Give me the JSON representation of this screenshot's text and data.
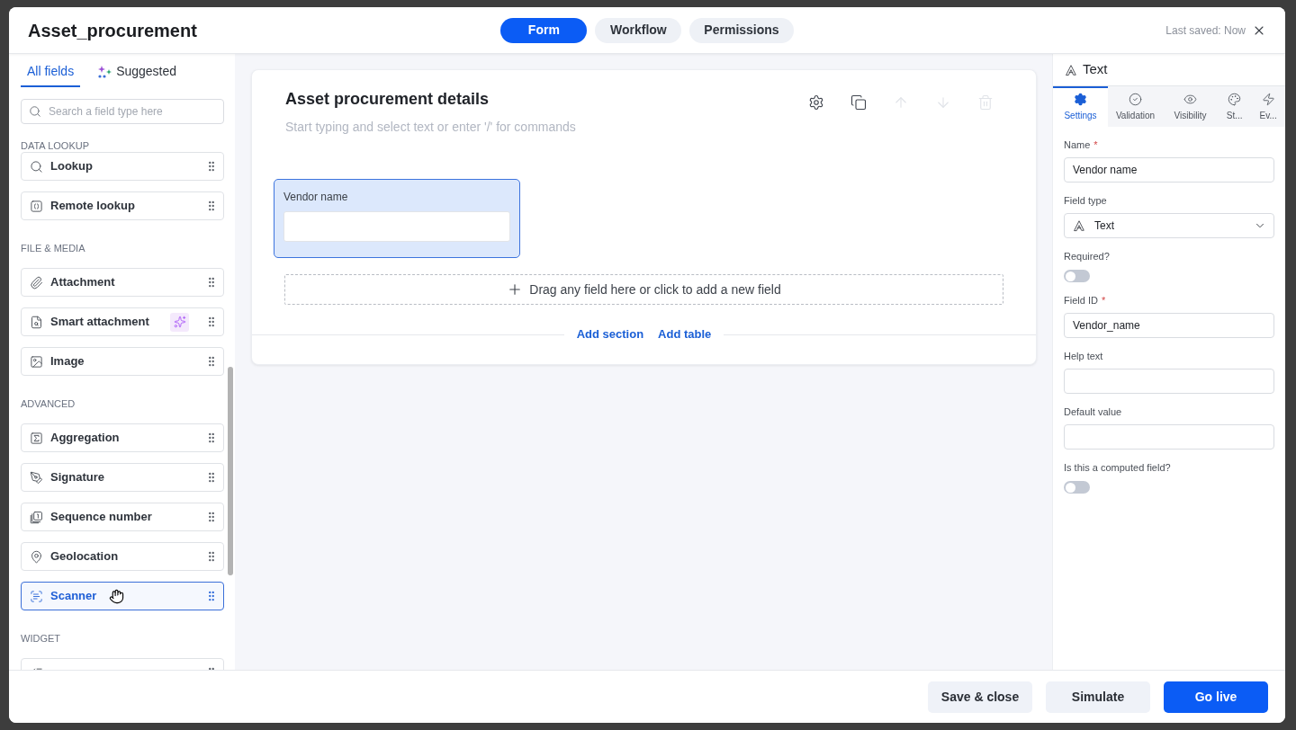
{
  "window": {
    "title": "Asset_procurement",
    "last_saved": "Last saved: Now"
  },
  "view_tabs": [
    {
      "label": "Form",
      "selected": true
    },
    {
      "label": "Workflow",
      "selected": false
    },
    {
      "label": "Permissions",
      "selected": false
    }
  ],
  "sidebar": {
    "tabs": [
      {
        "label": "All fields",
        "selected": true,
        "kind": "plain"
      },
      {
        "label": "Suggested",
        "selected": false,
        "kind": "ai"
      }
    ],
    "search": {
      "placeholder": "Search a field type here"
    },
    "groups": [
      {
        "heading": "DATA LOOKUP",
        "items": [
          {
            "label": "Lookup",
            "kind": "lookup",
            "hovered": false,
            "ai": false
          },
          {
            "label": "Remote lookup",
            "kind": "remote",
            "hovered": false,
            "ai": false
          }
        ]
      },
      {
        "heading": "FILE & MEDIA",
        "items": [
          {
            "label": "Attachment",
            "kind": "attachment",
            "hovered": false,
            "ai": false
          },
          {
            "label": "Smart attachment",
            "kind": "smart",
            "hovered": false,
            "ai": true
          },
          {
            "label": "Image",
            "kind": "image",
            "hovered": false,
            "ai": false
          }
        ]
      },
      {
        "heading": "ADVANCED",
        "items": [
          {
            "label": "Aggregation",
            "kind": "aggregation",
            "hovered": false,
            "ai": false
          },
          {
            "label": "Signature",
            "kind": "signature",
            "hovered": false,
            "ai": false
          },
          {
            "label": "Sequence number",
            "kind": "sequence",
            "hovered": false,
            "ai": false
          },
          {
            "label": "Geolocation",
            "kind": "geolocation",
            "hovered": false,
            "ai": false
          },
          {
            "label": "Scanner",
            "kind": "scanner",
            "hovered": true,
            "ai": false
          }
        ]
      },
      {
        "heading": "WIDGET",
        "items": [
          {
            "kind": "checklist",
            "hovered": false,
            "ai": false
          }
        ]
      }
    ]
  },
  "canvas": {
    "section": {
      "title": "Asset procurement details",
      "description_placeholder": "Start typing and select text or enter '/' for commands",
      "toolbar": [
        {
          "kind": "settings",
          "disabled": false
        },
        {
          "kind": "duplicate",
          "disabled": false
        },
        {
          "kind": "move_up",
          "disabled": true
        },
        {
          "kind": "move_down",
          "disabled": true
        },
        {
          "kind": "delete",
          "disabled": true
        }
      ],
      "fields": [
        {
          "label": "Vendor name",
          "selected": true
        }
      ],
      "drop_zone": "Drag any field here or click to add a new field",
      "links": [
        "Add section",
        "Add table"
      ]
    }
  },
  "properties": {
    "title": "Text",
    "tabs": [
      {
        "label": "Settings",
        "kind": "settings",
        "selected": true
      },
      {
        "label": "Validation",
        "kind": "validation",
        "selected": false
      },
      {
        "label": "Visibility",
        "kind": "visibility",
        "selected": false
      },
      {
        "label": "St...",
        "kind": "style",
        "selected": false
      },
      {
        "label": "Ev...",
        "kind": "events",
        "selected": false
      }
    ],
    "fields": [
      {
        "kind": "input",
        "label": "Name",
        "required_mark": "*",
        "value": "Vendor name"
      },
      {
        "kind": "select",
        "label": "Field type",
        "value": "Text"
      },
      {
        "kind": "toggle",
        "label": "Required?",
        "on": false
      },
      {
        "kind": "input",
        "label": "Field ID",
        "required_mark": "*",
        "value": "Vendor_name"
      },
      {
        "kind": "input",
        "label": "Help text"
      },
      {
        "kind": "input",
        "label": "Default value"
      },
      {
        "kind": "toggle",
        "label": "Is this a computed field?",
        "on": false
      }
    ]
  },
  "footer": {
    "buttons": [
      {
        "label": "Save & close",
        "kind": "secondary"
      },
      {
        "label": "Simulate",
        "kind": "secondary"
      },
      {
        "label": "Go live",
        "kind": "primary"
      }
    ]
  }
}
